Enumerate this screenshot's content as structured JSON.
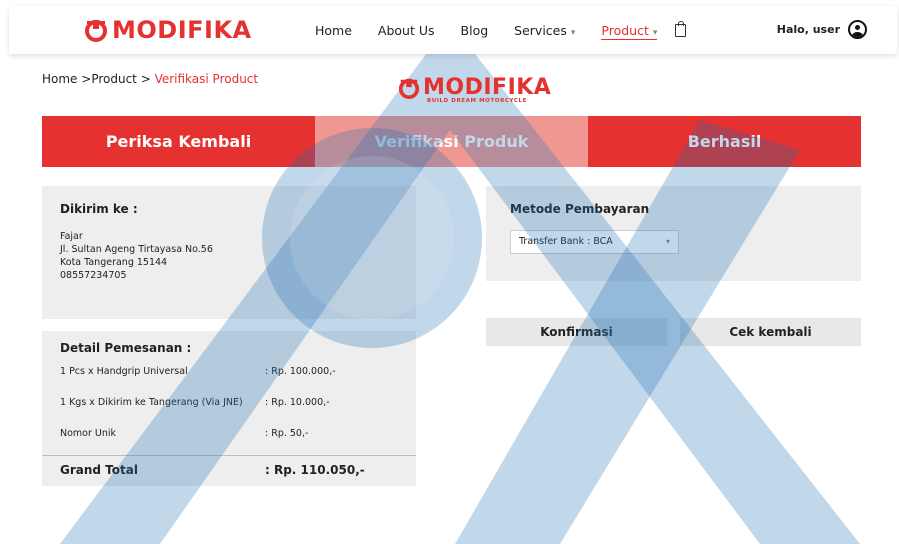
{
  "brand": {
    "name": "MODIFIKA",
    "tagline": "BUILD DREAM MOTORCYCLE",
    "color": "#e5312f"
  },
  "nav": {
    "items": [
      "Home",
      "About Us",
      "Blog",
      "Services",
      "Product"
    ],
    "active": "Product",
    "cart_icon": "shopping-bag-icon"
  },
  "user": {
    "greeting": "Halo, user",
    "icon": "user-circle-icon"
  },
  "breadcrumb": {
    "home": "Home",
    "sep1": " >",
    "product": "Product",
    "sep2": " > ",
    "current": "Verifikasi Product"
  },
  "steps": [
    "Periksa Kembali",
    "Verifikasi Produk",
    "Berhasil"
  ],
  "shipping": {
    "title": "Dikirim ke :",
    "name": "Fajar",
    "address": "Jl. Sultan Ageng Tirtayasa No.56",
    "city": "Kota Tangerang 15144",
    "phone": "08557234705"
  },
  "order": {
    "title": "Detail Pemesanan :",
    "items": [
      {
        "label": "1 Pcs  x   Handgrip Universal",
        "price": ": Rp. 100.000,-"
      },
      {
        "label": "1 Kgs  x   Dikirim ke Tangerang (Via JNE)",
        "price": ":  Rp. 10.000,-"
      },
      {
        "label": "Nomor Unik",
        "price": ": Rp. 50,-"
      }
    ],
    "total_label": "Grand Total",
    "total_value": ": Rp. 110.050,-"
  },
  "payment": {
    "title": "Metode Pembayaran",
    "selected": "Transfer Bank : BCA"
  },
  "buttons": {
    "confirm": "Konfirmasi",
    "back": "Cek kembali"
  },
  "colors": {
    "accent": "#e5312f",
    "accent_light": "#f19792",
    "card": "#eeeeee",
    "watermark": "#1f6fb4"
  }
}
